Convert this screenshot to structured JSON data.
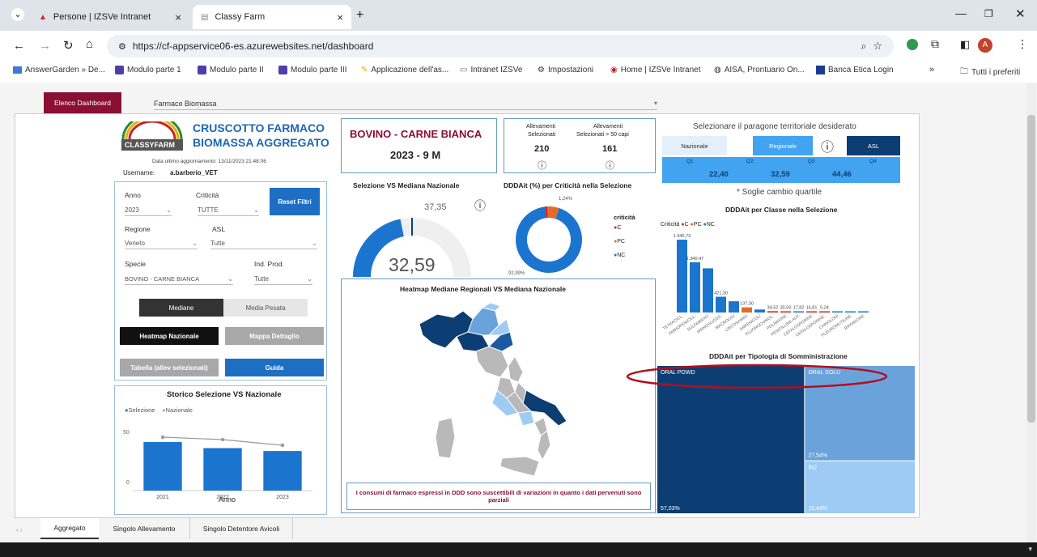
{
  "browser": {
    "tabs": [
      {
        "label": "Persone | IZSVe Intranet"
      },
      {
        "label": "Classy Farm"
      }
    ],
    "url": "https://cf-appservice06-es.azurewebsites.net/dashboard",
    "bookmarks": [
      "AnswerGarden » De...",
      "Modulo parte 1",
      "Modulo parte II",
      "Modulo parte III",
      "Applicazione dell'as...",
      "Intranet IZSVe",
      "Impostazioni",
      "Home | IZSVe Intranet",
      "AISA, Prontuario On...",
      "Banca Etica Login"
    ],
    "all_bookmarks": "Tutti i preferiti",
    "profile_initial": "A"
  },
  "top": {
    "dashboard_list": "Elenco Dashboard",
    "dashboard_select": "Farmaco Biomassa"
  },
  "header": {
    "logo_text": "CLASSYFARM",
    "title_line1": "CRUSCOTTO FARMACO",
    "title_line2": "BIOMASSA AGGREGATO",
    "last_update": "Data ultimo aggiornamento: 13/11/2023 21:48:06",
    "username_label": "Username:",
    "username_value": "a.barberio_VET"
  },
  "filters": {
    "anno_label": "Anno",
    "anno_value": "2023",
    "criticita_label": "Criticità",
    "criticita_value": "TUTTE",
    "reset": "Reset Filtri",
    "regione_label": "Regione",
    "regione_value": "Veneto",
    "asl_label": "ASL",
    "asl_value": "Tutte",
    "specie_label": "Specie",
    "specie_value": "BOVINO - CARNE BIANCA",
    "indprod_label": "Ind. Prod.",
    "indprod_value": "Tutte",
    "mediane": "Mediane",
    "media_pesata": "Media Pesata",
    "heatmap_naz": "Heatmap Nazionale",
    "mappa_dett": "Mappa Dettaglio",
    "tabella": "Tabella (allev selezionati)",
    "guida": "Guida"
  },
  "species_card": {
    "title": "BOVINO - CARNE BIANCA",
    "period": "2023 - 9 M"
  },
  "counts": {
    "sel_label_1": "Allevamenti",
    "sel_label_2": "Selezionati",
    "sel_value": "210",
    "over_label_1": "Allevamenti",
    "over_label_2": "Selezionati > 50 capi",
    "over_value": "161"
  },
  "gauge": {
    "title": "Selezione VS Mediana Nazionale",
    "value": "32,59",
    "target_label": "37,35",
    "value_num": 32.59,
    "target_num": 37.35,
    "max_num": 74.7
  },
  "donut": {
    "title": "DDDAit (%) per Criticità nella Selezione",
    "legend_title": "criticità",
    "top_label": "1,24%",
    "bottom_label": "92,99%"
  },
  "criticita_legend": [
    "C",
    "PC",
    "NC"
  ],
  "heatmap": {
    "title": "Heatmap Mediane Regionali VS Mediana Nazionale"
  },
  "notice": "I consumi di farmaco espressi in DDD sono suscettibili di variazioni in quanto i dati pervenuti sono parziali",
  "history": {
    "title": "Storico Selezione VS Nazionale",
    "legend_sel": "Selezione",
    "legend_naz": "Nazionale",
    "xlabel": "Anno",
    "y50": "50",
    "y0": "0"
  },
  "territory": {
    "title": "Selezionare il paragone territoriale desiderato",
    "options": [
      "Nazionale",
      "Regionale",
      "ASL"
    ],
    "quartiles": [
      "Q1",
      "Q2",
      "Q3",
      "Q4"
    ],
    "values": [
      "22,40",
      "32,59",
      "44,46"
    ],
    "note": "* Soglie cambio quartile"
  },
  "classe": {
    "title": "DDDAit per Classe nella Selezione",
    "legend_title": "Criticità"
  },
  "tipologia": {
    "title": "DDDAit per Tipologia di Somministrazione"
  },
  "bottom_tabs": [
    "Aggregato",
    "Singolo Allevamento",
    "Singolo Detentore Avicoli"
  ],
  "colors": {
    "dark": "#0d3e73",
    "blue": "#1b75cf",
    "light": "#9dcbf3",
    "accent": "#8b0f34",
    "orange": "#e06b2c",
    "red": "#d0202a"
  },
  "chart_data": [
    {
      "type": "bar",
      "title": "DDDAit per Classe nella Selezione",
      "categories": [
        "TETRACICL.",
        "AMINOPENICILL.",
        "SULFAMIDICI",
        "AMINOGLICOS.",
        "MACROLIDI",
        "LINCOSAMIDI",
        "AMFENICOLI",
        "FLUOROCHINOL.",
        "POLIMIXINE",
        "PENICILLINE ALP.",
        "CEFALOSPORINE",
        "CEFALOSPORINE.",
        "CHINOLONI",
        "PLEUROMUTILINE",
        "RIFAMICINE"
      ],
      "value_labels": [
        "1.945,73",
        "1.340,47",
        "",
        "421,30",
        "",
        "137,30",
        "",
        "34,52",
        "30,50",
        "17,82",
        "16,81",
        "5,24",
        "",
        "",
        ""
      ],
      "values": [
        1945.73,
        1340.47,
        1180,
        421.3,
        300,
        137.3,
        80,
        34.52,
        30.5,
        17.82,
        16.81,
        5.24,
        3,
        2,
        1
      ],
      "criticita": [
        "NC",
        "NC",
        "NC",
        "NC",
        "NC",
        "PC",
        "NC",
        "C",
        "C",
        "NC",
        "C",
        "C",
        "NC",
        "NC",
        "NC"
      ],
      "legend": [
        "C",
        "PC",
        "NC"
      ]
    },
    {
      "type": "bar",
      "title": "Storico Selezione VS Nazionale",
      "categories": [
        "2021",
        "2022",
        "2023"
      ],
      "series": [
        {
          "name": "Selezione",
          "values": [
            40,
            35,
            32.59
          ]
        },
        {
          "name": "Nazionale",
          "values": [
            44,
            42,
            37.35
          ]
        }
      ],
      "xlabel": "Anno",
      "ylim": [
        0,
        60
      ]
    },
    {
      "type": "pie",
      "title": "DDDAit (%) per Criticità nella Selezione",
      "labels": [
        "C",
        "PC",
        "NC"
      ],
      "values": [
        1.24,
        5.77,
        92.99
      ]
    },
    {
      "type": "area",
      "title": "DDDAit per Tipologia di Somministrazione",
      "labels": [
        "ORAL POWD",
        "ORAL SOLU",
        "INJ"
      ],
      "values": [
        57.03,
        27.54,
        15.44
      ],
      "value_labels": [
        "57,03%",
        "27,54%",
        "15,44%"
      ]
    }
  ]
}
